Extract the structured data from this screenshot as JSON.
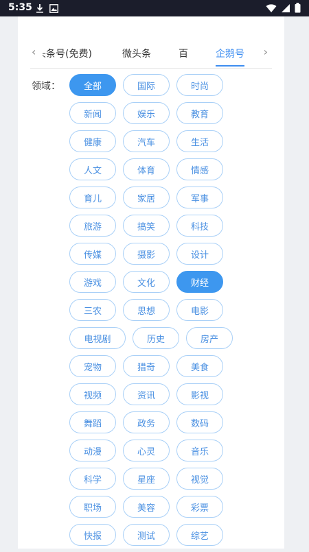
{
  "status_bar": {
    "time": "5:35",
    "left_icons": [
      "download-icon",
      "image-icon"
    ],
    "right_icons": [
      "wifi-icon",
      "signal-icon",
      "battery-icon"
    ]
  },
  "tabs": {
    "items": [
      "头条号(免费)",
      "微头条",
      "百",
      "企鹅号"
    ],
    "active_index": 3
  },
  "filter": {
    "label": "领域：",
    "selected": [
      "全部",
      "财经"
    ],
    "rows": [
      [
        "全部",
        "国际",
        "时尚"
      ],
      [
        "新闻",
        "娱乐",
        "教育"
      ],
      [
        "健康",
        "汽车",
        "生活"
      ],
      [
        "人文",
        "体育",
        "情感"
      ],
      [
        "育儿",
        "家居",
        "军事"
      ],
      [
        "旅游",
        "搞笑",
        "科技"
      ],
      [
        "传媒",
        "摄影",
        "设计"
      ],
      [
        "游戏",
        "文化",
        "财经"
      ],
      [
        "三农",
        "思想",
        "电影"
      ],
      [
        "电视剧",
        "历史",
        "房产"
      ],
      [
        "宠物",
        "猎奇",
        "美食"
      ],
      [
        "视频",
        "资讯",
        "影视"
      ],
      [
        "舞蹈",
        "政务",
        "数码"
      ],
      [
        "动漫",
        "心灵",
        "音乐"
      ],
      [
        "科学",
        "星座",
        "视觉"
      ],
      [
        "职场",
        "美容",
        "彩票"
      ],
      [
        "快报",
        "测试",
        "综艺"
      ]
    ]
  }
}
